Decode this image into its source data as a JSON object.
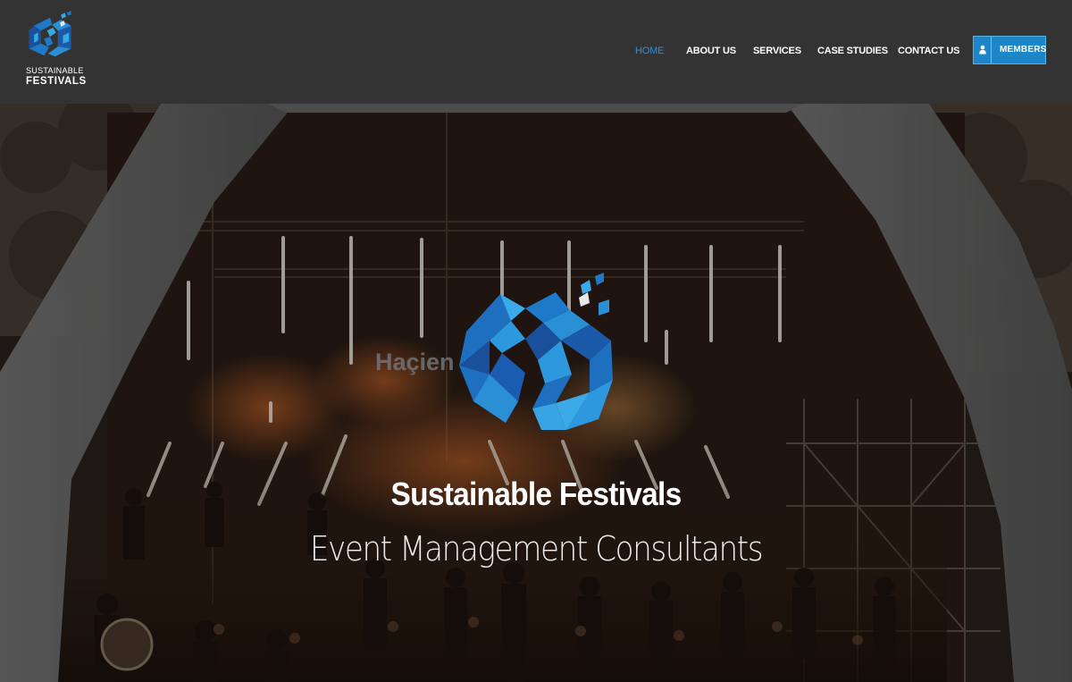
{
  "brand": {
    "line1": "SUSTAINABLE",
    "line2": "FESTIVALS",
    "logo_icon": "sf-logo-icon",
    "colors": {
      "dark_blue": "#1b4f9c",
      "mid_blue": "#1f79c9",
      "light_blue": "#37a9e6"
    }
  },
  "nav": {
    "items": [
      {
        "label": "HOME",
        "active": true
      },
      {
        "label": "ABOUT US",
        "active": false
      },
      {
        "label": "SERVICES",
        "active": false
      },
      {
        "label": "CASE STUDIES",
        "active": false
      },
      {
        "label": "CONTACT US",
        "active": false
      }
    ],
    "active_color": "#2e8fd0",
    "members": {
      "label": "MEMBERS",
      "icon": "user-icon",
      "color": "#1d86c9"
    }
  },
  "hero": {
    "stage_sign": "Haçien",
    "title": "Sustainable Festivals",
    "subtitle": "Event Management Consultants",
    "background": "festival-stage-orchestra-photo"
  },
  "colors": {
    "header_bg": "#333334",
    "text": "#ffffff"
  }
}
